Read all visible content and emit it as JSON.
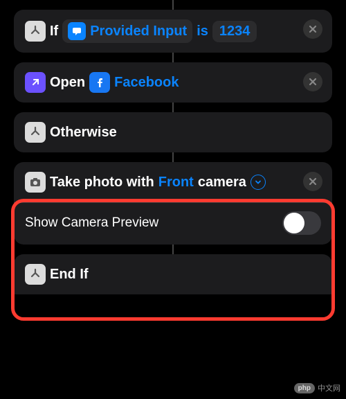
{
  "if_card": {
    "label_if": "If",
    "input_token": "Provided Input",
    "condition": "is",
    "value": "1234"
  },
  "open_card": {
    "label_open": "Open",
    "app_name": "Facebook"
  },
  "otherwise_card": {
    "label": "Otherwise"
  },
  "photo_card": {
    "prefix": "Take photo with",
    "camera_token": "Front",
    "suffix": "camera",
    "option_label": "Show Camera Preview"
  },
  "endif_card": {
    "label": "End If"
  },
  "watermark": {
    "badge": "php",
    "text": "中文网"
  }
}
